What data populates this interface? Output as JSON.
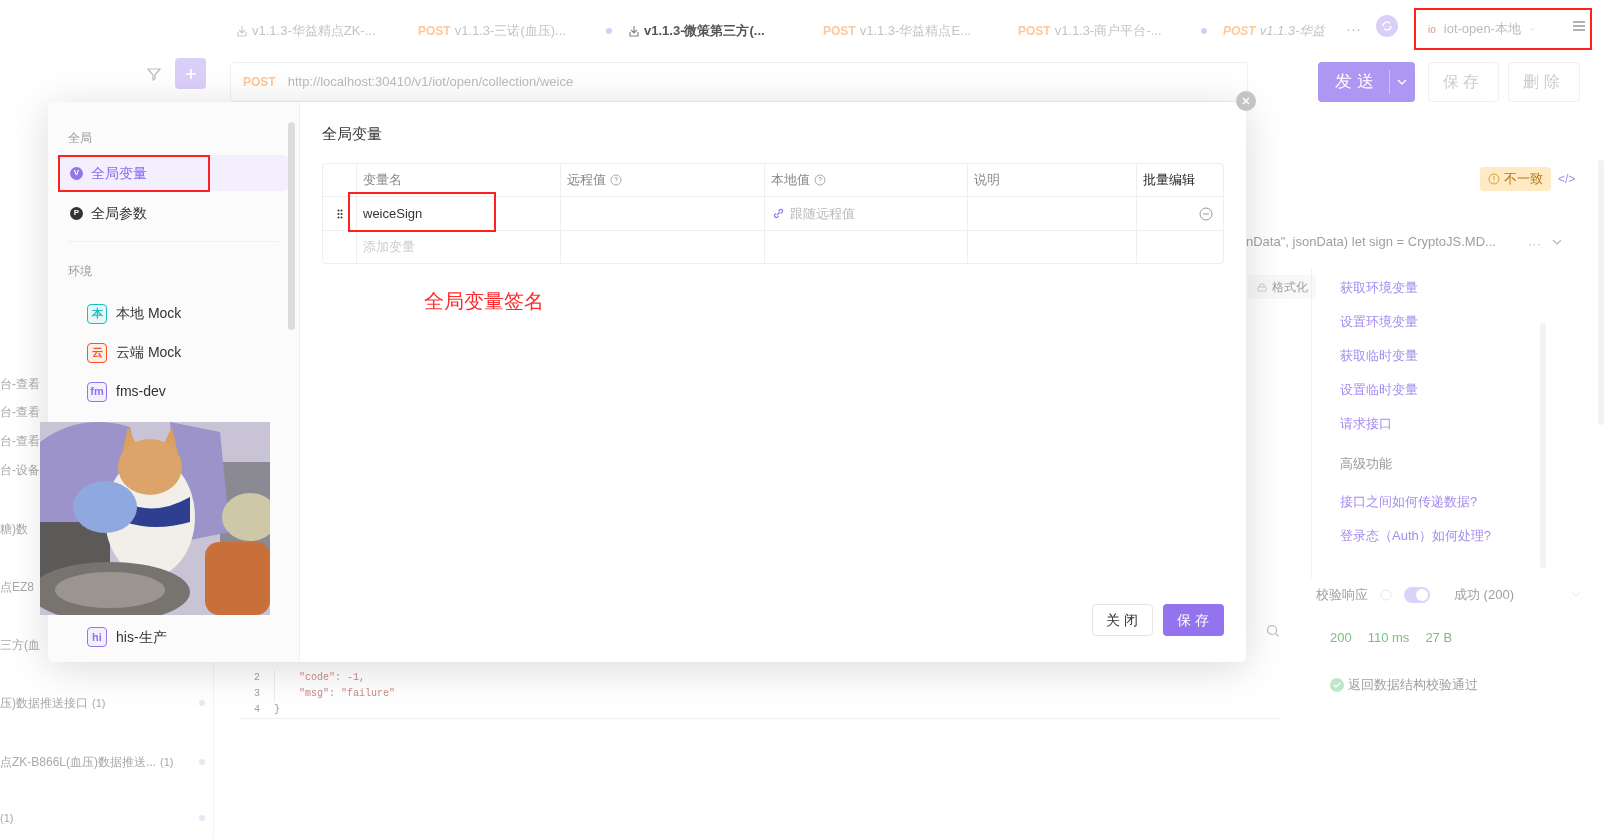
{
  "tabs": [
    {
      "kind": "doc",
      "label": "v1.1.3-华益精点ZK-...",
      "selected": false,
      "modified": false,
      "preview": false
    },
    {
      "kind": "request",
      "method": "POST",
      "label": "v1.1.3-三诺(血压)...",
      "selected": false,
      "modified": true,
      "preview": false
    },
    {
      "kind": "doc",
      "label": "v1.1.3-微策第三方(...",
      "selected": true,
      "modified": false,
      "preview": false
    },
    {
      "kind": "request",
      "method": "POST",
      "label": "v1.1.3-华益精点E...",
      "selected": false,
      "modified": false,
      "preview": false
    },
    {
      "kind": "request",
      "method": "POST",
      "label": "v1.1.3-商户平台-...",
      "selected": false,
      "modified": true,
      "preview": false
    },
    {
      "kind": "request",
      "method": "POST",
      "label": "v1.1.3-华益",
      "selected": false,
      "modified": false,
      "preview": true
    }
  ],
  "tab_more": "···",
  "environment": {
    "badge": "io",
    "name": "iot-open-本地"
  },
  "request": {
    "method": "POST",
    "url": "http://localhost:30410/v1/iot/open/collection/weice"
  },
  "actions": {
    "send": "发送",
    "save": "保存",
    "delete": "删除"
  },
  "sidebar_fragments": [
    {
      "text": "台-查看"
    },
    {
      "text": "台-查看"
    },
    {
      "text": "台-查看"
    },
    {
      "text": "台-设备"
    },
    {
      "text": "糖)数"
    },
    {
      "text": "点EZ8"
    },
    {
      "text": "三方(血"
    },
    {
      "text": "压)数据推送接口",
      "count": "(1)"
    },
    {
      "text": "点ZK-B866L(血压)数据推送...",
      "count": "(1)"
    },
    {
      "count": "(1)"
    }
  ],
  "response_code": [
    {
      "line": "2",
      "text": "\"code\": -1,"
    },
    {
      "line": "3",
      "text": "\"msg\": \"failure\""
    },
    {
      "line": "4",
      "text": "}"
    }
  ],
  "right_panel": {
    "badge": "不一致",
    "code_icon": "</>",
    "script_preview": "nData\", jsonData) let sign = CryptoJS.MD...",
    "more": "···",
    "format": "格式化",
    "snippets": [
      {
        "kind": "link",
        "label": "获取环境变量"
      },
      {
        "kind": "link",
        "label": "设置环境变量"
      },
      {
        "kind": "link",
        "label": "获取临时变量"
      },
      {
        "kind": "link",
        "label": "设置临时变量"
      },
      {
        "kind": "link",
        "label": "请求接口"
      },
      {
        "kind": "heading",
        "label": "高级功能"
      },
      {
        "kind": "link",
        "label": "接口之间如何传递数据?"
      },
      {
        "kind": "link",
        "label": "登录态（Auth）如何处理?"
      }
    ]
  },
  "validation": {
    "label": "校验响应",
    "on": true,
    "response": "成功 (200)",
    "stats": [
      "200",
      "110 ms",
      "27 B"
    ],
    "result": "返回数据结构校验通过"
  },
  "dialog": {
    "nav": [
      {
        "label": "全局",
        "items": [
          {
            "icon": "V",
            "label": "全局变量",
            "selected": true
          },
          {
            "icon": "P",
            "label": "全局参数",
            "selected": false
          }
        ]
      },
      {
        "label": "环境",
        "environments": [
          {
            "badge": "本",
            "label": "本地 Mock",
            "color": "#13c2c2"
          },
          {
            "badge": "云",
            "label": "云端 Mock",
            "color": "#fa541c"
          },
          {
            "badge": "fm",
            "label": "fms-dev",
            "color": "#9373ee"
          },
          {
            "badge": "hi",
            "label": "his-生产",
            "color": "#9373ee"
          }
        ]
      }
    ],
    "title": "全局变量",
    "columns": [
      {
        "label": "变量名",
        "help": false
      },
      {
        "label": "远程值",
        "help": true
      },
      {
        "label": "本地值",
        "help": true
      },
      {
        "label": "说明",
        "help": false
      }
    ],
    "bulk_edit": "批量编辑",
    "rows": [
      {
        "name": "weiceSign",
        "local_placeholder": "跟随远程值"
      }
    ],
    "add_placeholder": "添加变量",
    "note": "全局变量签名",
    "close": "关闭",
    "save": "保存"
  }
}
